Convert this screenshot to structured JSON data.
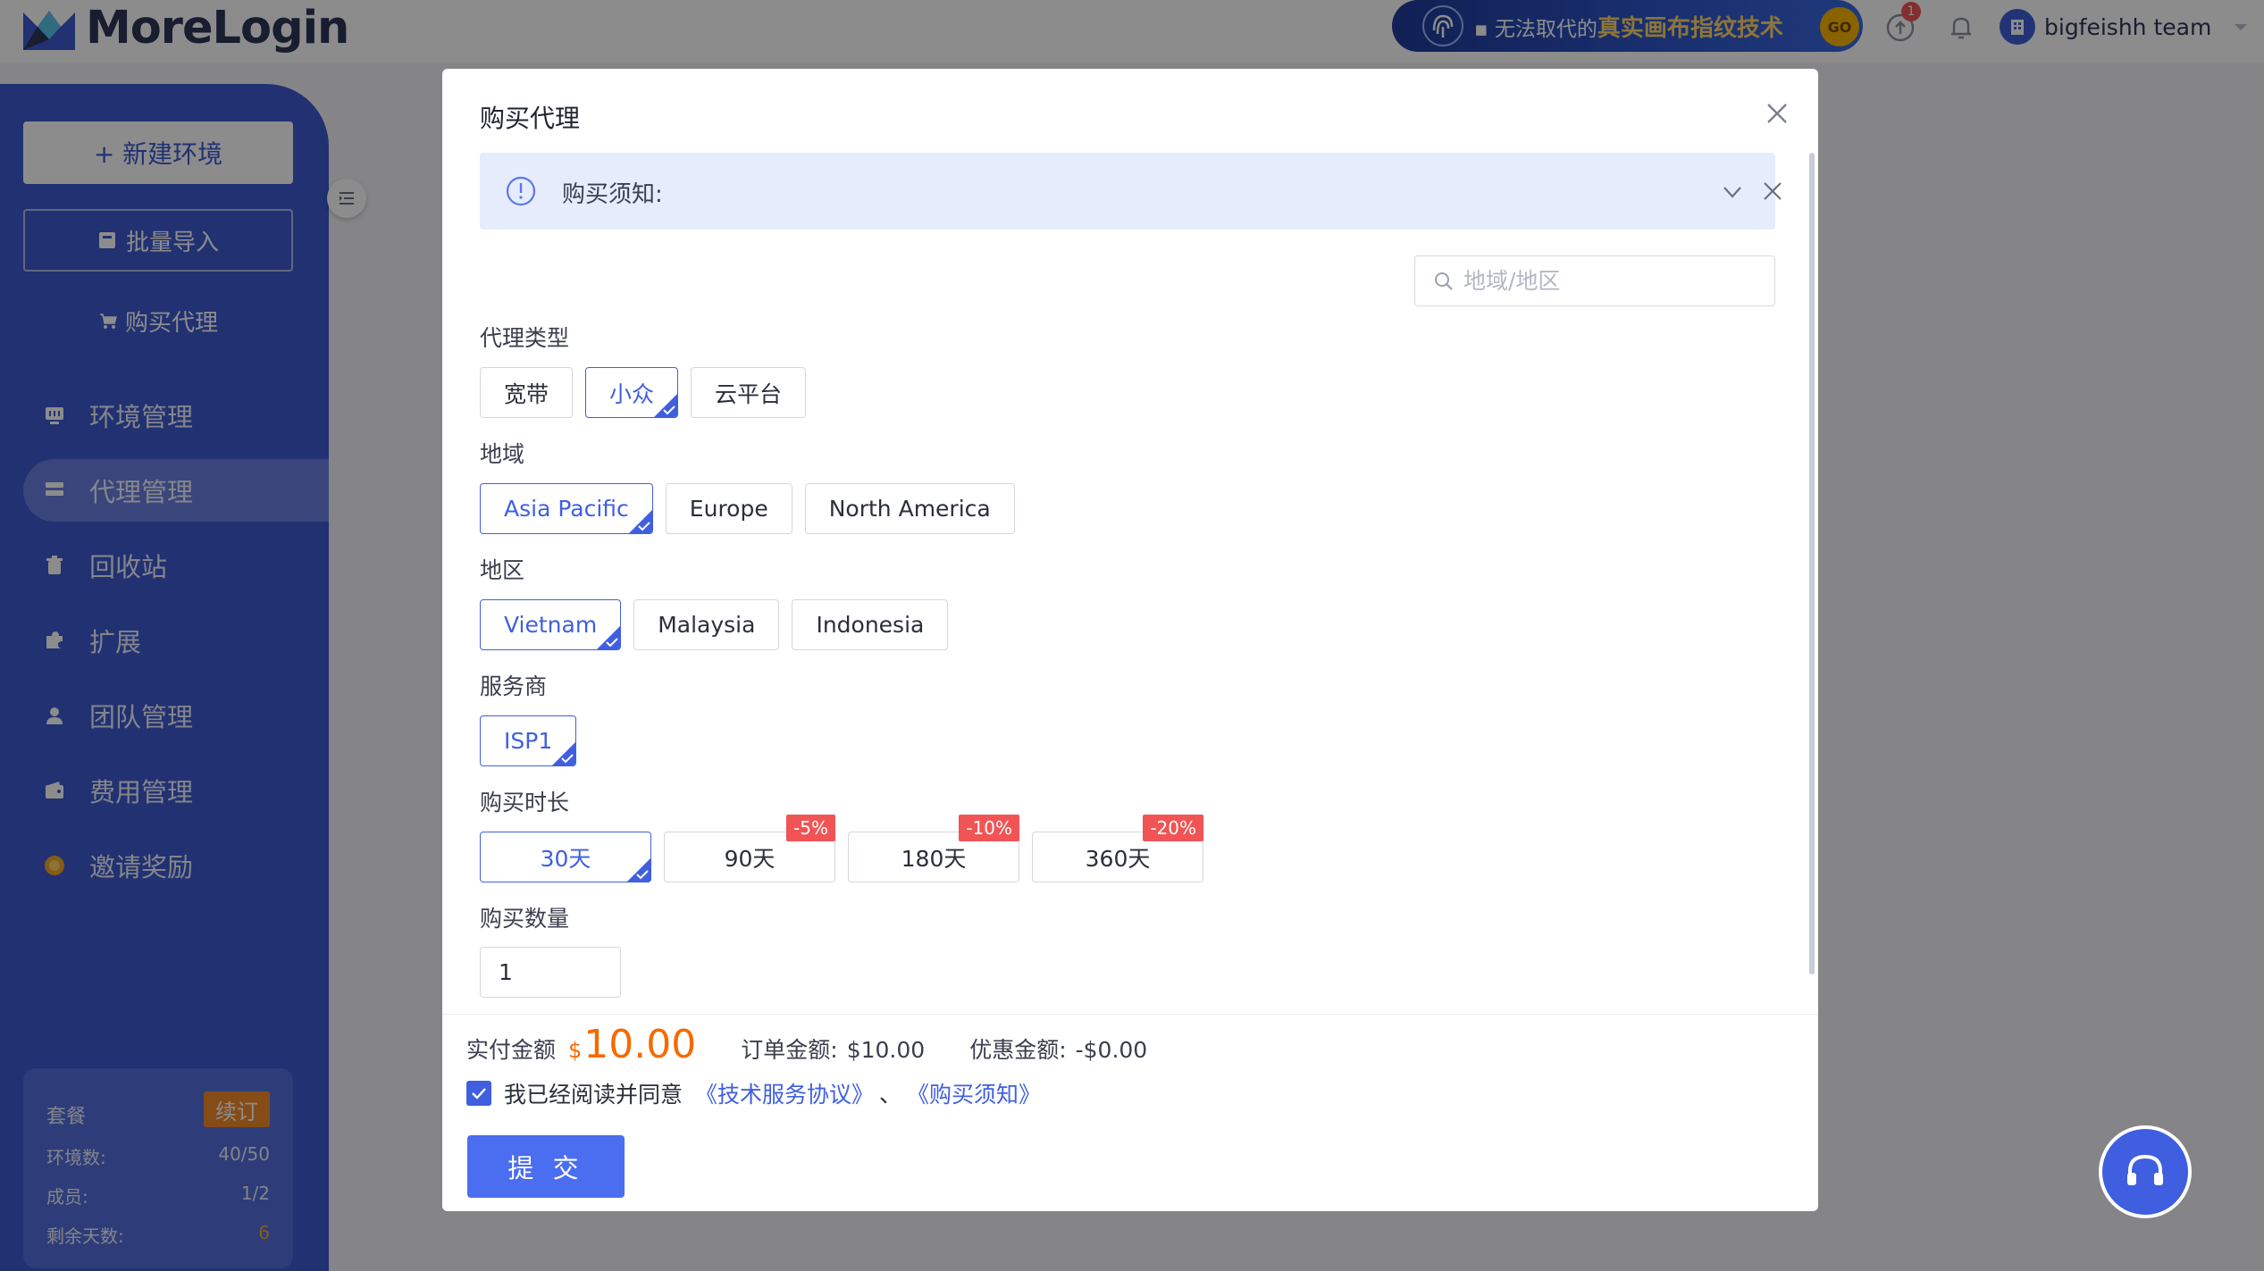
{
  "app": {
    "name": "MoreLogin"
  },
  "header": {
    "banner": {
      "text_prefix": "无法取代的",
      "text_highlight": "真实画布指纹技术",
      "badge": "GO"
    },
    "update_badge": "1",
    "team_name": "bigfeishh team"
  },
  "sidebar": {
    "new_env": "+ 新建环境",
    "batch_import": "批量导入",
    "buy_proxy": "购买代理",
    "items": [
      {
        "label": "环境管理",
        "icon": "monitor-icon"
      },
      {
        "label": "代理管理",
        "icon": "proxy-icon",
        "active": true
      },
      {
        "label": "回收站",
        "icon": "trash-icon"
      },
      {
        "label": "扩展",
        "icon": "puzzle-icon"
      },
      {
        "label": "团队管理",
        "icon": "user-icon"
      },
      {
        "label": "费用管理",
        "icon": "wallet-icon"
      },
      {
        "label": "邀请奖励",
        "icon": "coin-icon"
      }
    ],
    "plan": {
      "title": "套餐",
      "renew": "续订",
      "rows": [
        {
          "label": "环境数:",
          "value": "40/50"
        },
        {
          "label": "成员:",
          "value": "1/2"
        },
        {
          "label": "剩余天数:",
          "value": "6"
        }
      ]
    }
  },
  "modal": {
    "title": "购买代理",
    "notice": "购买须知:",
    "search_placeholder": "地域/地区",
    "proxy_type": {
      "label": "代理类型",
      "options": [
        "宽带",
        "小众",
        "云平台"
      ],
      "selected": 1
    },
    "region": {
      "label": "地域",
      "options": [
        "Asia Pacific",
        "Europe",
        "North America"
      ],
      "selected": 0
    },
    "area": {
      "label": "地区",
      "options": [
        "Vietnam",
        "Malaysia",
        "Indonesia"
      ],
      "selected": 0
    },
    "provider": {
      "label": "服务商",
      "options": [
        "ISP1"
      ],
      "selected": 0
    },
    "duration": {
      "label": "购买时长",
      "options": [
        {
          "label": "30天",
          "discount": ""
        },
        {
          "label": "90天",
          "discount": "-5%"
        },
        {
          "label": "180天",
          "discount": "-10%"
        },
        {
          "label": "360天",
          "discount": "-20%"
        }
      ],
      "selected": 0
    },
    "quantity": {
      "label": "购买数量",
      "value": "1"
    },
    "footer": {
      "pay_label": "实付金额",
      "currency": "$",
      "pay_amount": "10.00",
      "order_label": "订单金额:",
      "order_amount": "$10.00",
      "discount_label": "优惠金额:",
      "discount_amount": "-$0.00",
      "agree_text": "我已经阅读并同意",
      "link_service": "《技术服务协议》",
      "separator": "、",
      "link_notice": "《购买须知》",
      "submit": "提 交"
    }
  },
  "colors": {
    "primary": "#3f5fe0",
    "sidebar": "#3c59d0",
    "price": "#f56a00",
    "discount": "#f05454"
  }
}
